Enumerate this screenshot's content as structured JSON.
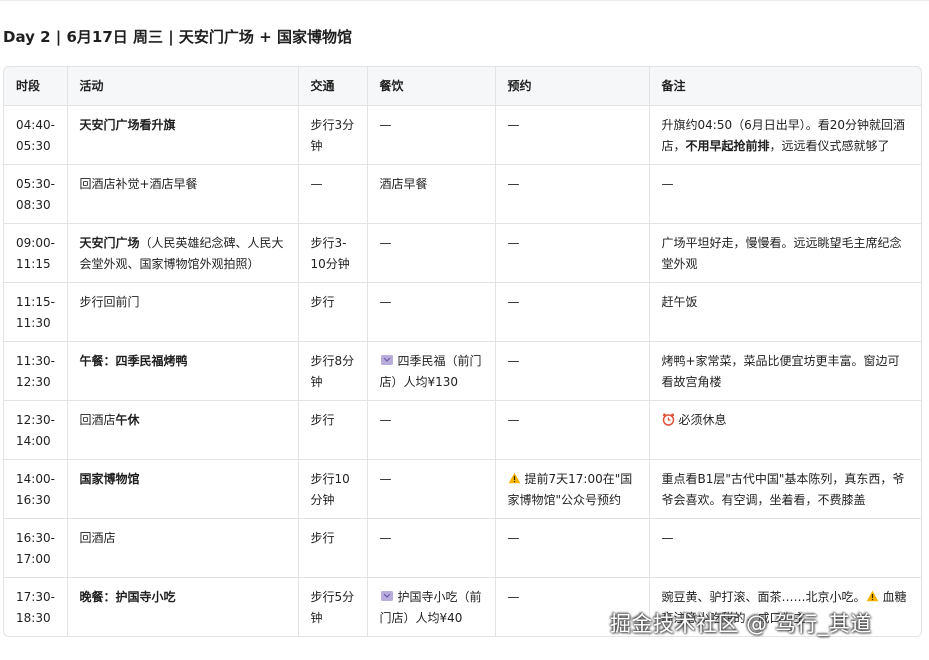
{
  "heading": "Day 2 | 6月17日 周三 | 天安门广场 + 国家博物馆",
  "table": {
    "headers": [
      "时段",
      "活动",
      "交通",
      "餐饮",
      "预约",
      "备注"
    ],
    "rows": [
      {
        "time": "04:40-05:30",
        "activity": "天安门广场看升旗",
        "activity_bold": true,
        "transport": "步行3分钟",
        "food": "—",
        "booking": "—",
        "notes_a": "升旗约04:50（6月日出早）。看20分钟就回酒店，",
        "notes_b": "不用早起抢前排",
        "notes_c": "，远远看仪式感就够了"
      },
      {
        "time": "05:30-08:30",
        "activity": "回酒店补觉+酒店早餐",
        "transport": "—",
        "food": "酒店早餐",
        "booking": "—",
        "notes": "—"
      },
      {
        "time": "09:00-11:15",
        "activity_bold_part": "天安门广场",
        "activity_rest": "（人民英雄纪念碑、人民大会堂外观、国家博物馆外观拍照）",
        "transport": "步行3-10分钟",
        "food": "—",
        "booking": "—",
        "notes": "广场平坦好走，慢慢看。远远眺望毛主席纪念堂外观"
      },
      {
        "time": "11:15-11:30",
        "activity": "步行回前门",
        "transport": "步行",
        "food": "—",
        "booking": "—",
        "notes": "赶午饭"
      },
      {
        "time": "11:30-12:30",
        "activity": "午餐：四季民福烤鸭",
        "activity_bold": true,
        "transport": "步行8分钟",
        "food": "四季民福（前门店）人均¥130",
        "food_icon": "pin-icon",
        "booking": "—",
        "notes": "烤鸭+家常菜，菜品比便宜坊更丰富。窗边可看故宫角楼"
      },
      {
        "time": "12:30-14:00",
        "activity_plain_part": "回酒店",
        "activity_bold_part": "午休",
        "transport": "步行",
        "food": "—",
        "booking": "—",
        "notes": "必须休息",
        "notes_icon": "alarm-clock-icon"
      },
      {
        "time": "14:00-16:30",
        "activity": "国家博物馆",
        "activity_bold": true,
        "transport": "步行10分钟",
        "food": "—",
        "booking": "提前7天17:00在\"国家博物馆\"公众号预约",
        "booking_icon": "warning-icon",
        "notes": "重点看B1层\"古代中国\"基本陈列，真东西，爷爷会喜欢。有空调，坐着看，不费膝盖"
      },
      {
        "time": "16:30-17:00",
        "activity": "回酒店",
        "transport": "步行",
        "food": "—",
        "booking": "—",
        "notes": "—"
      },
      {
        "time": "17:30-18:30",
        "activity": "晚餐：护国寺小吃",
        "activity_bold": true,
        "transport": "步行5分钟",
        "food": "护国寺小吃（前门店）人均¥40",
        "food_icon": "pin-icon",
        "booking": "—",
        "notes_a": "豌豆黄、驴打滚、面茶……北京小吃。",
        "notes_b": "血糖",
        "notes_b_icon": "warning-icon",
        "notes_c": "高注意少吃甜的，咸口为主"
      }
    ]
  },
  "watermark": "掘金技术社区 @ 驾行_其道",
  "colors": {
    "header_bg": "#f6f7f9",
    "border": "#e3e3e3",
    "text": "#1f1f1f",
    "warning": "#f4b400",
    "pin": "#8e7cc3",
    "clock": "#e0533d"
  }
}
